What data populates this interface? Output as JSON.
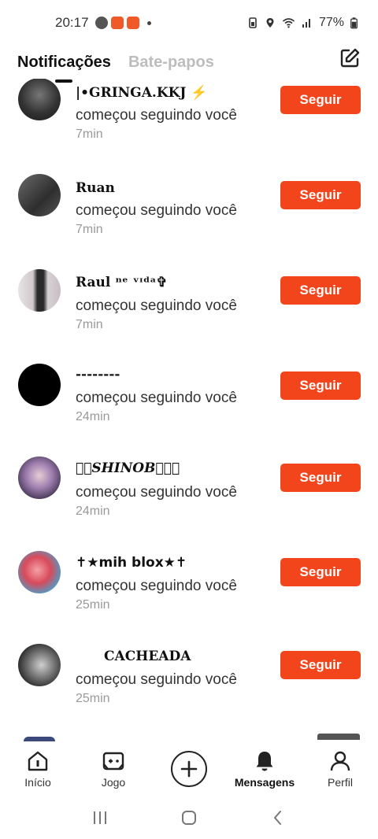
{
  "status": {
    "time": "20:17",
    "battery": "77%"
  },
  "tabs": [
    {
      "label": "Notificações",
      "active": true
    },
    {
      "label": "Bate-papos",
      "active": false
    }
  ],
  "notifications": [
    {
      "name": "|•GRINGA.KKJ ⚡",
      "action": "começou seguindo você",
      "time": "7min",
      "button": "Seguir",
      "avatar_color": "#3a3a3a"
    },
    {
      "name": "Ruan",
      "action": "começou seguindo você",
      "time": "7min",
      "button": "Seguir",
      "avatar_color": "#4a4a4a"
    },
    {
      "name": "Raul ⁿᵉ ᵛᶦᵈᵃ✞",
      "action": "começou seguindo você",
      "time": "7min",
      "button": "Seguir",
      "avatar_color": "#b9b2b5"
    },
    {
      "name": "--------",
      "action": "começou seguindo você",
      "time": "24min",
      "button": "Seguir",
      "avatar_color": "#000000"
    },
    {
      "name": "♛♔SHINOB⃠♔♛",
      "action": "começou seguindo você",
      "time": "24min",
      "button": "Seguir",
      "avatar_color": "#8c6a9e"
    },
    {
      "name": "✝★mih blox★✝",
      "action": "começou seguindo você",
      "time": "25min",
      "button": "Seguir",
      "avatar_color": "#d9534f"
    },
    {
      "name": "CACHEADA",
      "action": "começou seguindo você",
      "time": "25min",
      "button": "Seguir",
      "avatar_color": "#2f2f2f"
    }
  ],
  "bottom_nav": [
    {
      "label": "Início",
      "icon": "home-icon"
    },
    {
      "label": "Jogo",
      "icon": "gamepad-icon"
    },
    {
      "label": "",
      "icon": "plus-icon"
    },
    {
      "label": "Mensagens",
      "icon": "bell-icon",
      "active": true
    },
    {
      "label": "Perfil",
      "icon": "profile-icon"
    }
  ],
  "colors": {
    "accent": "#f2451c",
    "muted": "#9a9a9a"
  }
}
